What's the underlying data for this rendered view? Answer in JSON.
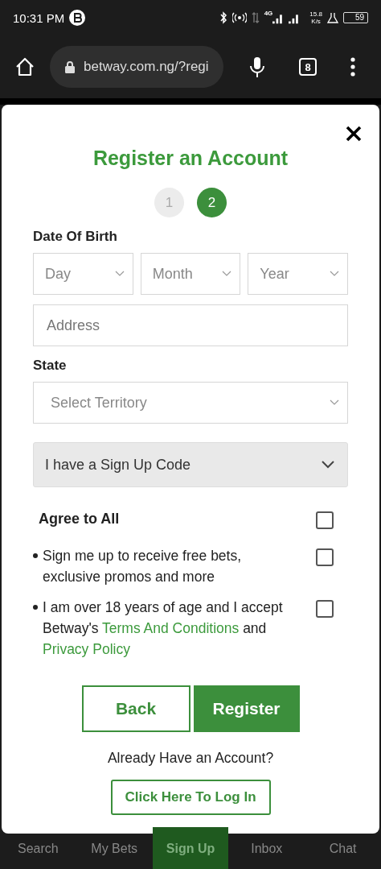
{
  "status_bar": {
    "time": "10:31 PM",
    "network": "4G",
    "speed": "15.8",
    "speed_unit": "K/s",
    "battery": "59"
  },
  "browser": {
    "url": "betway.com.ng/?regi",
    "tab_count": "8"
  },
  "modal": {
    "title": "Register an Account",
    "steps": [
      {
        "label": "1",
        "selected": false
      },
      {
        "label": "2",
        "selected": true
      }
    ],
    "date_of_birth": {
      "label": "Date Of Birth",
      "fields": [
        {
          "placeholder": "Day"
        },
        {
          "placeholder": "Month"
        },
        {
          "placeholder": "Year"
        }
      ]
    },
    "address": {
      "placeholder": "Address"
    },
    "state": {
      "label": "State",
      "placeholder": "Select Territory"
    },
    "signup_code": {
      "label": "I have a Sign Up Code",
      "expanded": false
    },
    "agree_all": {
      "label": "Agree to All",
      "checked": false
    },
    "consents": [
      {
        "text": "Sign me up to receive free bets, exclusive promos and more",
        "checked": false
      },
      {
        "text": "I am over 18 years of age and I accept Betway's",
        "link": "Terms And Conditions",
        "middle": "and",
        "link2": "Privacy Policy",
        "checked": false
      }
    ],
    "buttons": {
      "back": "Back",
      "register": "Register"
    },
    "login_prompt": "Already Have an Account?",
    "login_button": "Click Here To Log In"
  },
  "bottom_nav": [
    {
      "label": "Search",
      "selected": false
    },
    {
      "label": "My Bets",
      "selected": false
    },
    {
      "label": "Sign Up",
      "selected": true
    },
    {
      "label": "Inbox",
      "selected": false
    },
    {
      "label": "Chat",
      "selected": false
    }
  ]
}
